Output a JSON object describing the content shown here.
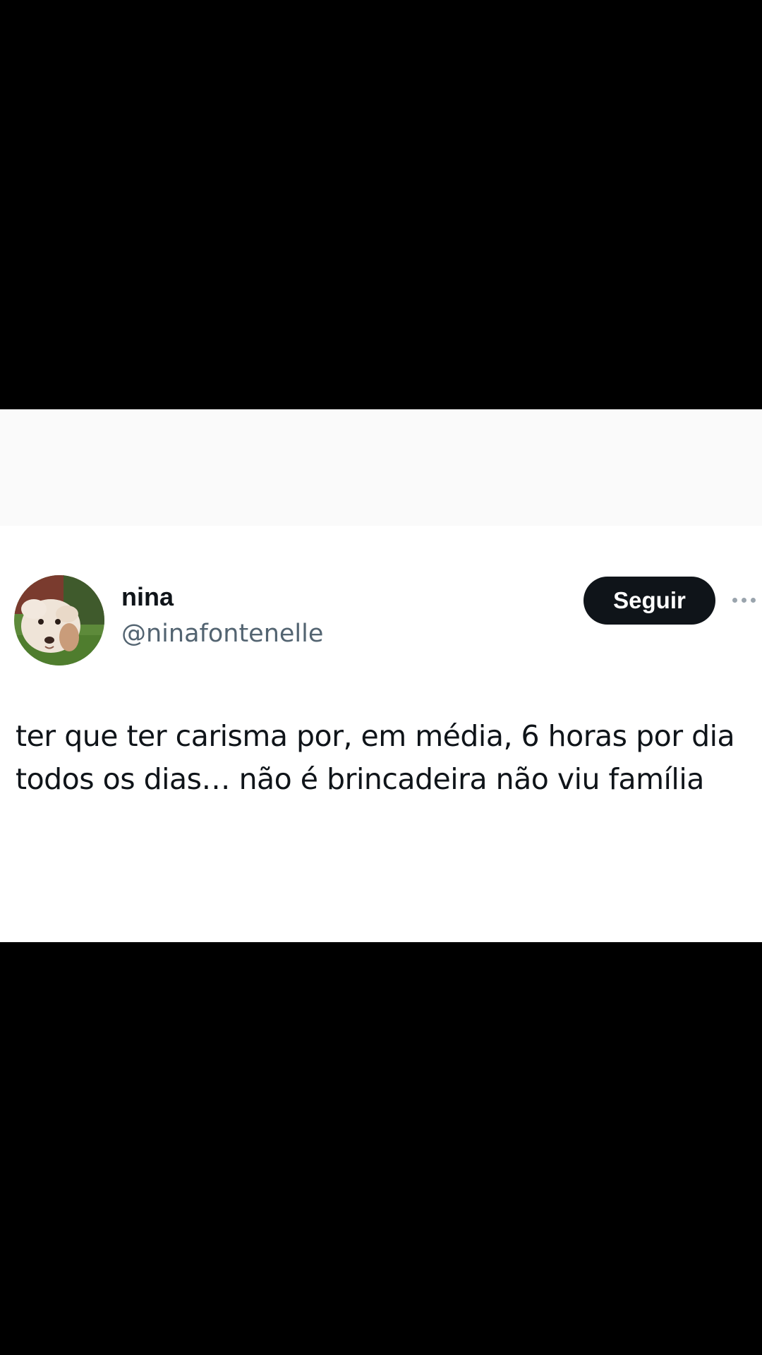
{
  "tweet": {
    "display_name": "nina",
    "handle": "@ninafontenelle",
    "follow_label": "Seguir",
    "text": "ter que ter carisma por, em média, 6 horas por dia todos os dias… não é brincadeira não viu família"
  },
  "icons": {
    "avatar": "avatar-photo-dog",
    "more": "more-options-dots-icon"
  },
  "colors": {
    "text_primary": "#0f1419",
    "text_secondary": "#536471",
    "button_bg": "#0f1419",
    "button_text": "#ffffff",
    "background": "#ffffff",
    "letterbox": "#000000"
  }
}
